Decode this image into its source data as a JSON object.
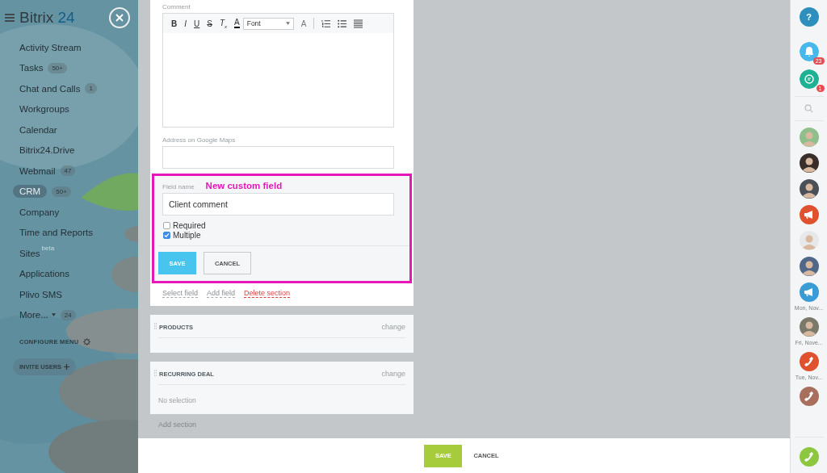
{
  "sidebar": {
    "logo": {
      "name": "Bitrix",
      "number": "24"
    },
    "items": [
      {
        "label": "Activity Stream",
        "selected": false
      },
      {
        "label": "Tasks",
        "badge": "50+",
        "selected": false
      },
      {
        "label": "Chat and Calls",
        "badge": "1",
        "selected": false
      },
      {
        "label": "Workgroups",
        "selected": false
      },
      {
        "label": "Calendar",
        "selected": false
      },
      {
        "label": "Bitrix24.Drive",
        "selected": false
      },
      {
        "label": "Webmail",
        "badge": "47",
        "selected": false
      },
      {
        "label": "CRM",
        "badge": "50+",
        "selected": true
      },
      {
        "label": "Company",
        "selected": false
      },
      {
        "label": "Time and Reports",
        "selected": false
      },
      {
        "label": "Sites",
        "tag": "beta",
        "selected": false
      },
      {
        "label": "Applications",
        "selected": false
      },
      {
        "label": "Plivo SMS",
        "selected": false
      },
      {
        "label": "More...",
        "badge": "24",
        "dropdown": true,
        "selected": false
      }
    ],
    "configure_menu": "CONFIGURE MENU",
    "invite_users": "INVITE USERS"
  },
  "form": {
    "comment_label": "Comment",
    "font_select": "Font",
    "toolbar": [
      {
        "kind": "bold",
        "label": "B"
      },
      {
        "kind": "italic",
        "label": "I"
      },
      {
        "kind": "underline",
        "label": "U"
      },
      {
        "kind": "strike",
        "label": "S"
      },
      {
        "kind": "clear",
        "label": "T",
        "sub": "x"
      },
      {
        "kind": "color",
        "label": "A"
      }
    ],
    "font_size": "A",
    "address_label": "Address on Google Maps",
    "custom_field": {
      "annotation": "New custom field",
      "label": "Field name",
      "value": "Client comment",
      "options": [
        {
          "label": "Required",
          "checked": false
        },
        {
          "label": "Multiple",
          "checked": true
        }
      ],
      "save": "SAVE",
      "cancel": "CANCEL"
    },
    "links": [
      {
        "label": "Select field",
        "kind": "normal"
      },
      {
        "label": "Add field",
        "kind": "normal"
      },
      {
        "label": "Delete section",
        "kind": "danger"
      }
    ],
    "sections": [
      {
        "title": "PRODUCTS",
        "action": "change"
      },
      {
        "title": "RECURRING DEAL",
        "action": "change",
        "value": "No selection"
      }
    ],
    "add_section": "Add section"
  },
  "footer": {
    "save": "SAVE",
    "cancel": "CANCEL"
  },
  "right_bar": {
    "help": "?",
    "notifications_badge": "23",
    "chat_badge": "1",
    "contacts": [
      {
        "kind": "avatar",
        "color": "#8fbf8a"
      },
      {
        "kind": "avatar",
        "color": "#3a2e2a"
      },
      {
        "kind": "avatar",
        "color": "#4a5058"
      },
      {
        "kind": "megaphone",
        "color": "#e0512f"
      },
      {
        "kind": "avatar",
        "color": "#e8e8ea"
      },
      {
        "kind": "avatar",
        "color": "#51678a"
      },
      {
        "kind": "megaphone",
        "color": "#3a9bd5",
        "caption": "Mon, Nov..."
      },
      {
        "kind": "avatar",
        "color": "#7b7a6a",
        "caption": "Fri, Nove..."
      },
      {
        "kind": "phone",
        "color": "#e0512f",
        "caption": "Tue, Nov..."
      },
      {
        "kind": "phone",
        "color": "#a8705c"
      }
    ]
  }
}
